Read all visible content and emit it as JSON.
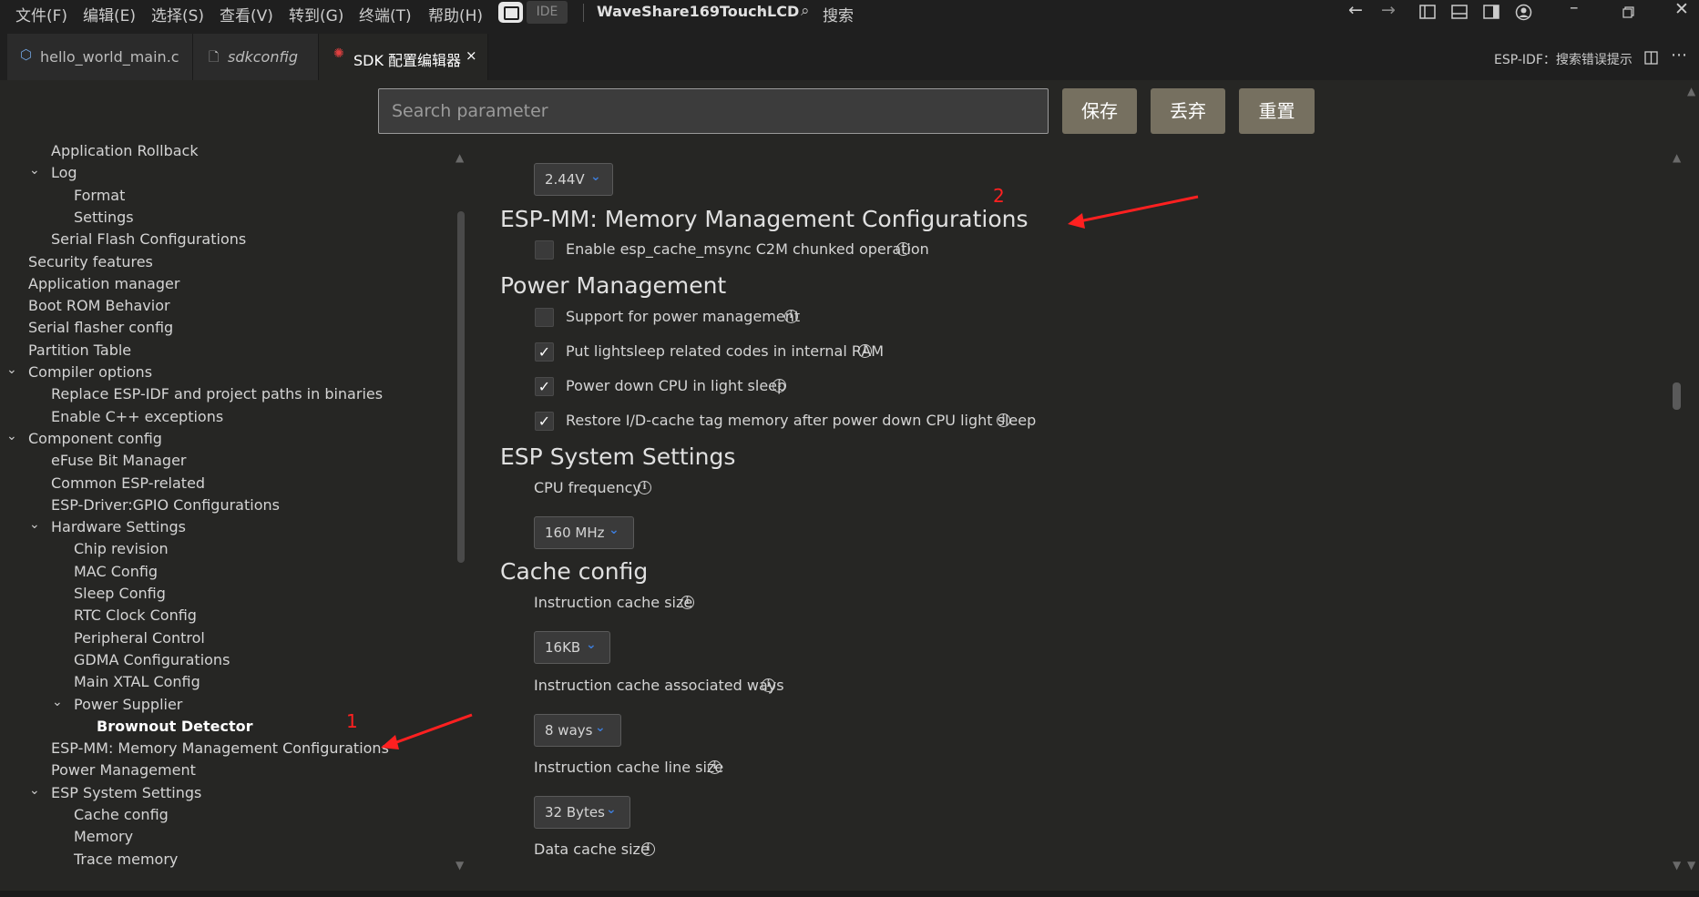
{
  "menubar": {
    "items": [
      "文件(F)",
      "编辑(E)",
      "选择(S)",
      "查看(V)",
      "转到(G)",
      "终端(T)",
      "帮助(H)"
    ],
    "ide_label": "IDE",
    "workspace": "WaveShare169TouchLCD",
    "search_label": "搜索",
    "icons": [
      "back-arrow-icon",
      "forward-arrow-icon",
      "toggle-sidebar-icon",
      "toggle-panel-icon",
      "toggle-secondary-sidebar-icon",
      "account-icon",
      "minimize-icon",
      "restore-icon",
      "close-icon"
    ]
  },
  "tabs": [
    {
      "label": "hello_world_main.c",
      "icon": "c-file-icon",
      "active": false
    },
    {
      "label": "sdkconfig",
      "icon": "file-icon",
      "active": false,
      "italic": true
    },
    {
      "label": "SDK 配置编辑器",
      "icon": "espressif-icon",
      "active": true,
      "close": "×"
    }
  ],
  "tabbar_right": {
    "label": "ESP-IDF：搜索错误提示"
  },
  "search": {
    "placeholder": "Search parameter",
    "value": ""
  },
  "actions": {
    "save": "保存",
    "discard": "丢弃",
    "reset": "重置"
  },
  "tree": [
    {
      "label": "Application Rollback",
      "level": 2,
      "twistie": ""
    },
    {
      "label": "Log",
      "level": 2,
      "twistie": "expanded"
    },
    {
      "label": "Format",
      "level": 3,
      "twistie": ""
    },
    {
      "label": "Settings",
      "level": 3,
      "twistie": ""
    },
    {
      "label": "Serial Flash Configurations",
      "level": 2,
      "twistie": ""
    },
    {
      "label": "Security features",
      "level": 1,
      "twistie": ""
    },
    {
      "label": "Application manager",
      "level": 1,
      "twistie": ""
    },
    {
      "label": "Boot ROM Behavior",
      "level": 1,
      "twistie": ""
    },
    {
      "label": "Serial flasher config",
      "level": 1,
      "twistie": ""
    },
    {
      "label": "Partition Table",
      "level": 1,
      "twistie": ""
    },
    {
      "label": "Compiler options",
      "level": 1,
      "twistie": "expanded"
    },
    {
      "label": "Replace ESP-IDF and project paths in binaries",
      "level": 2,
      "twistie": ""
    },
    {
      "label": "Enable C++ exceptions",
      "level": 2,
      "twistie": ""
    },
    {
      "label": "Component config",
      "level": 1,
      "twistie": "expanded"
    },
    {
      "label": "eFuse Bit Manager",
      "level": 2,
      "twistie": ""
    },
    {
      "label": "Common ESP-related",
      "level": 2,
      "twistie": ""
    },
    {
      "label": "ESP-Driver:GPIO Configurations",
      "level": 2,
      "twistie": ""
    },
    {
      "label": "Hardware Settings",
      "level": 2,
      "twistie": "expanded"
    },
    {
      "label": "Chip revision",
      "level": 3,
      "twistie": ""
    },
    {
      "label": "MAC Config",
      "level": 3,
      "twistie": ""
    },
    {
      "label": "Sleep Config",
      "level": 3,
      "twistie": ""
    },
    {
      "label": "RTC Clock Config",
      "level": 3,
      "twistie": ""
    },
    {
      "label": "Peripheral Control",
      "level": 3,
      "twistie": ""
    },
    {
      "label": "GDMA Configurations",
      "level": 3,
      "twistie": ""
    },
    {
      "label": "Main XTAL Config",
      "level": 3,
      "twistie": ""
    },
    {
      "label": "Power Supplier",
      "level": 3,
      "twistie": "expanded"
    },
    {
      "label": "Brownout Detector",
      "level": 4,
      "twistie": "",
      "bold": true
    },
    {
      "label": "ESP-MM: Memory Management Configurations",
      "level": 2,
      "twistie": ""
    },
    {
      "label": "Power Management",
      "level": 2,
      "twistie": ""
    },
    {
      "label": "ESP System Settings",
      "level": 2,
      "twistie": "expanded"
    },
    {
      "label": "Cache config",
      "level": 3,
      "twistie": ""
    },
    {
      "label": "Memory",
      "level": 3,
      "twistie": ""
    },
    {
      "label": "Trace memory",
      "level": 3,
      "twistie": ""
    }
  ],
  "main": {
    "top_dropdown": {
      "value": "2.44V"
    },
    "esp_mm": {
      "title": "ESP-MM: Memory Management Configurations",
      "options": [
        {
          "label": "Enable esp_cache_msync C2M chunked operation",
          "checked": false
        }
      ]
    },
    "power_management": {
      "title": "Power Management",
      "options": [
        {
          "label": "Support for power management",
          "checked": false
        },
        {
          "label": "Put lightsleep related codes in internal RAM",
          "checked": true
        },
        {
          "label": "Power down CPU in light sleep",
          "checked": true
        },
        {
          "label": "Restore I/D-cache tag memory after power down CPU light sleep",
          "checked": true
        }
      ]
    },
    "system_settings": {
      "title": "ESP System Settings",
      "cpu_freq_label": "CPU frequency",
      "cpu_freq_value": "160 MHz"
    },
    "cache_config": {
      "title": "Cache config",
      "icache_size_label": "Instruction cache size",
      "icache_size_value": "16KB",
      "icache_ways_label": "Instruction cache associated ways",
      "icache_ways_value": "8 ways",
      "icache_line_label": "Instruction cache line size",
      "icache_line_value": "32 Bytes",
      "dcache_size_label": "Data cache size"
    },
    "check_mark": "✓",
    "info_glyph": "i",
    "chevron": "⌄"
  },
  "annotations": {
    "one": "1",
    "two": "2",
    "color": "#ff2020"
  }
}
